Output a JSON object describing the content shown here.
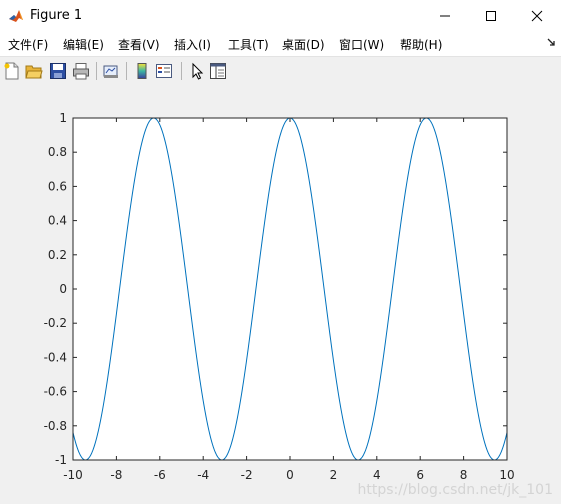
{
  "window": {
    "title": "Figure 1"
  },
  "menu": {
    "items": [
      "文件(F)",
      "编辑(E)",
      "查看(V)",
      "插入(I)",
      "工具(T)",
      "桌面(D)",
      "窗口(W)",
      "帮助(H)"
    ],
    "overflow_icon": "dock-arrow-icon"
  },
  "toolbar": {
    "buttons": [
      "new-figure-icon",
      "open-file-icon",
      "save-icon",
      "print-icon",
      "link-plot-icon",
      "colorbar-icon",
      "legend-icon",
      "select-arrow-icon",
      "property-inspector-icon"
    ]
  },
  "chart_data": {
    "type": "line",
    "title": "",
    "xlabel": "",
    "ylabel": "",
    "xlim": [
      -10,
      10
    ],
    "ylim": [
      -1,
      1
    ],
    "x_ticks": [
      "-10",
      "-8",
      "-6",
      "-4",
      "-2",
      "0",
      "2",
      "4",
      "6",
      "8",
      "10"
    ],
    "y_ticks": [
      "-1",
      "-0.8",
      "-0.6",
      "-0.4",
      "-0.2",
      "0",
      "0.2",
      "0.4",
      "0.6",
      "0.8",
      "1"
    ],
    "grid": false,
    "series": [
      {
        "function": "cos(x)",
        "color": "#0072bd",
        "x": [
          -10,
          -9.5,
          -9,
          -8.5,
          -8,
          -7.5,
          -7,
          -6.5,
          -6,
          -5.5,
          -5,
          -4.5,
          -4,
          -3.5,
          -3,
          -2.5,
          -2,
          -1.5,
          -1,
          -0.5,
          0,
          0.5,
          1,
          1.5,
          2,
          2.5,
          3,
          3.5,
          4,
          4.5,
          5,
          5.5,
          6,
          6.5,
          7,
          7.5,
          8,
          8.5,
          9,
          9.5,
          10
        ],
        "y": [
          -0.839,
          -0.997,
          -0.911,
          -0.602,
          -0.146,
          0.347,
          0.754,
          0.977,
          0.96,
          0.709,
          0.284,
          -0.211,
          -0.654,
          -0.936,
          -0.99,
          -0.801,
          -0.416,
          0.071,
          0.54,
          0.878,
          1,
          0.878,
          0.54,
          0.071,
          -0.416,
          -0.801,
          -0.99,
          -0.936,
          -0.654,
          -0.211,
          0.284,
          0.709,
          0.96,
          0.977,
          0.754,
          0.347,
          -0.146,
          -0.602,
          -0.911,
          -0.997,
          -0.839
        ]
      }
    ]
  },
  "watermark": "https://blog.csdn.net/jk_101"
}
